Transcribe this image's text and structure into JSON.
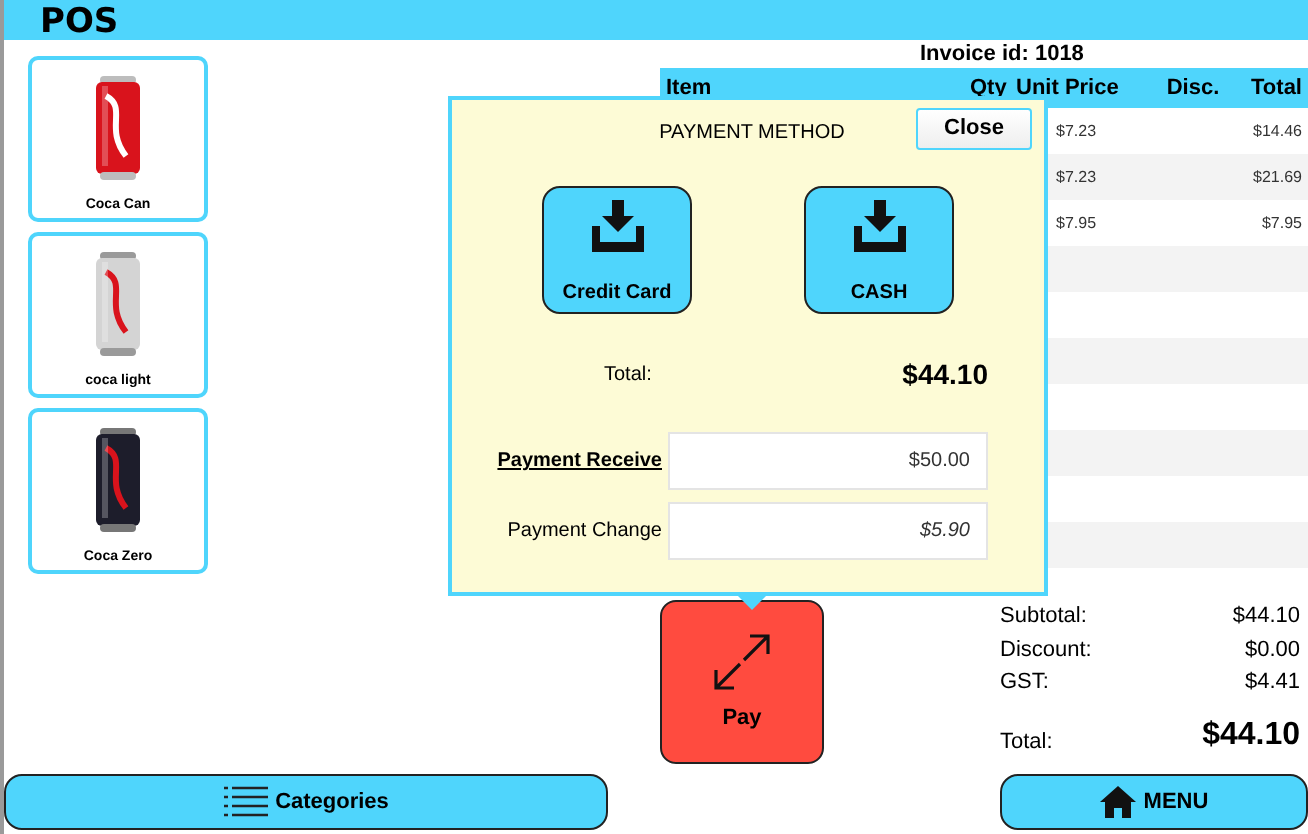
{
  "header": {
    "title": "POS"
  },
  "products": [
    {
      "name": "Coca Can"
    },
    {
      "name": "coca light"
    },
    {
      "name": "Coca Zero"
    }
  ],
  "invoice": {
    "label": "Invoice id: 1018"
  },
  "table": {
    "columns": [
      "Item",
      "Qty",
      "Unit Price",
      "Disc.",
      "Total"
    ],
    "rows": [
      {
        "unit_price": "$7.23",
        "total": "$14.46"
      },
      {
        "unit_price": "$7.23",
        "total": "$21.69"
      },
      {
        "unit_price": "$7.95",
        "total": "$7.95"
      }
    ]
  },
  "payment_dialog": {
    "title": "PAYMENT METHOD",
    "close": "Close",
    "methods": [
      {
        "label": "Credit Card"
      },
      {
        "label": "CASH"
      }
    ],
    "total_label": "Total:",
    "total_value": "$44.10",
    "fields": [
      {
        "kind": "received",
        "label": "Payment Receive",
        "value": "$50.00"
      },
      {
        "kind": "change",
        "label": "Payment Change",
        "value": "$5.90"
      }
    ]
  },
  "pay_button": {
    "label": "Pay"
  },
  "summary": [
    {
      "kind": "line",
      "label": "Subtotal:",
      "value": "$44.10"
    },
    {
      "kind": "line",
      "label": "Discount:",
      "value": "$0.00"
    },
    {
      "kind": "line",
      "label": "GST:",
      "value": "$4.41"
    },
    {
      "kind": "total",
      "label": "Total:",
      "value": "$44.10"
    }
  ],
  "footer": {
    "categories": "Categories",
    "menu": "MENU"
  }
}
